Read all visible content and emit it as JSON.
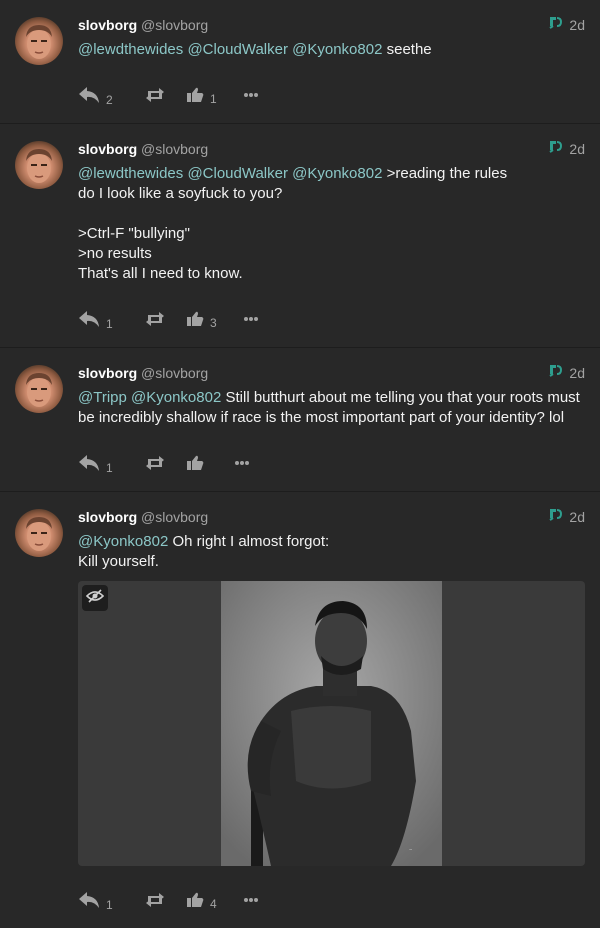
{
  "colors": {
    "mention": "#8cc7c7",
    "muted": "#a3a3a3",
    "background": "#282828"
  },
  "posts": [
    {
      "name": "slovborg",
      "handle": "@slovborg",
      "time": "2d",
      "mentions": "@lewdthewides @CloudWalker @Kyonko802",
      "text_inline": " seethe",
      "text_rest": "",
      "replies": "2",
      "likes": "1"
    },
    {
      "name": "slovborg",
      "handle": "@slovborg",
      "time": "2d",
      "mentions": "@lewdthewides @CloudWalker @Kyonko802",
      "text_inline": " >reading the rules",
      "text_rest": "do I look like a soyfuck to you?\n\n>Ctrl-F \"bullying\"\n>no results\nThat's all I need to know.",
      "replies": "1",
      "likes": "3"
    },
    {
      "name": "slovborg",
      "handle": "@slovborg",
      "time": "2d",
      "mentions": "@Tripp @Kyonko802",
      "text_inline": " Still butthurt about me telling you that your roots must be incredibly shallow if race is the most important part of your identity? lol",
      "text_rest": "",
      "replies": "1",
      "likes": ""
    },
    {
      "name": "slovborg",
      "handle": "@slovborg",
      "time": "2d",
      "mentions": "@Kyonko802",
      "text_inline": " Oh right I almost forgot:",
      "text_rest": "Kill yourself.",
      "replies": "1",
      "likes": "4"
    }
  ]
}
